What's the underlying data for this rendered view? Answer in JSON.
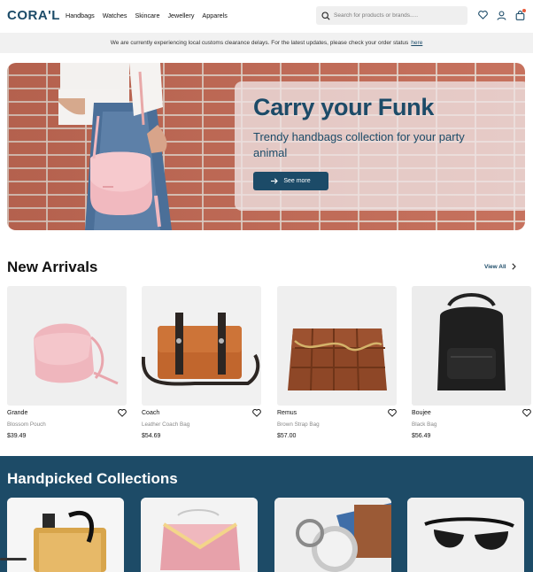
{
  "brand": {
    "logo": "CORA'L",
    "color": "#1c4b68"
  },
  "nav": {
    "items": [
      "Handbags",
      "Watches",
      "Skincare",
      "Jewellery",
      "Apparels"
    ]
  },
  "search": {
    "placeholder": "Search for products or brands....."
  },
  "header_icons": [
    "heart-icon",
    "user-icon",
    "bag-icon"
  ],
  "notice": {
    "text": "We are currently experiencing local customs clearance delays. For the latest updates, please check your order status",
    "link": "here"
  },
  "hero": {
    "title": "Carry your Funk",
    "subtitle": "Trendy handbags collection for your party animal",
    "cta": "See more"
  },
  "new_arrivals": {
    "title": "New Arrivals",
    "view_all": "View All",
    "products": [
      {
        "name": "Grande",
        "desc": "Blossom Pouch",
        "price": "$39.49"
      },
      {
        "name": "Coach",
        "desc": "Leather Coach Bag",
        "price": "$54.69"
      },
      {
        "name": "Remus",
        "desc": "Brown Strap Bag",
        "price": "$57.00"
      },
      {
        "name": "Boujee",
        "desc": "Black Bag",
        "price": "$56.49"
      }
    ]
  },
  "handpicked": {
    "title": "Handpicked Collections"
  }
}
